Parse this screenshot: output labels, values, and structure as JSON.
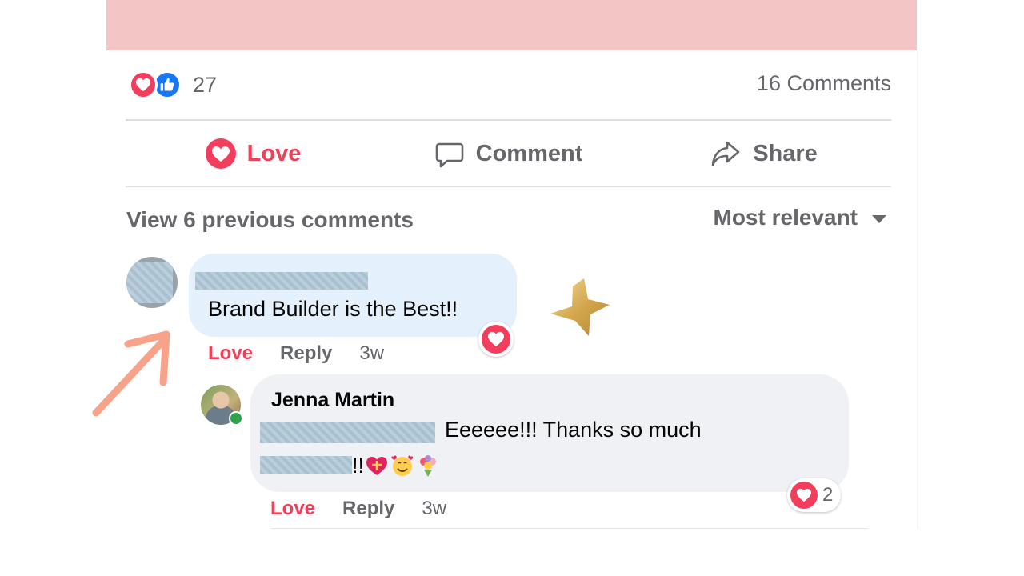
{
  "post": {
    "reaction_count": "27",
    "comments_count": "16 Comments"
  },
  "actions": {
    "love_label": "Love",
    "comment_label": "Comment",
    "share_label": "Share"
  },
  "comments_header": {
    "view_previous": "View 6 previous comments",
    "sort_label": "Most relevant"
  },
  "comment1": {
    "text": "Brand Builder is the Best!!",
    "love_label": "Love",
    "reply_label": "Reply",
    "time": "3w"
  },
  "reply1": {
    "author": "Jenna Martin",
    "text_line1": "Eeeeee!!! Thanks so much",
    "text_line2": "!!",
    "love_label": "Love",
    "reply_label": "Reply",
    "time": "3w",
    "reaction_count": "2"
  },
  "colors": {
    "love": "#f33e58",
    "like": "#1877f2",
    "muted_text": "#65676b",
    "comment_bubble_highlight": "#e4f0fc",
    "comment_bubble": "#eff1f4",
    "banner": "#f4c5c5",
    "arrow": "#f7a38a",
    "star": "#d9b25f"
  },
  "icons": [
    "heart-icon",
    "like-thumb-icon",
    "comment-icon",
    "share-icon",
    "caret-down-icon",
    "star-sticker-icon",
    "arrow-annotation-icon",
    "heart-with-ribbon-emoji",
    "smiling-face-with-hearts-emoji",
    "bouquet-emoji"
  ]
}
